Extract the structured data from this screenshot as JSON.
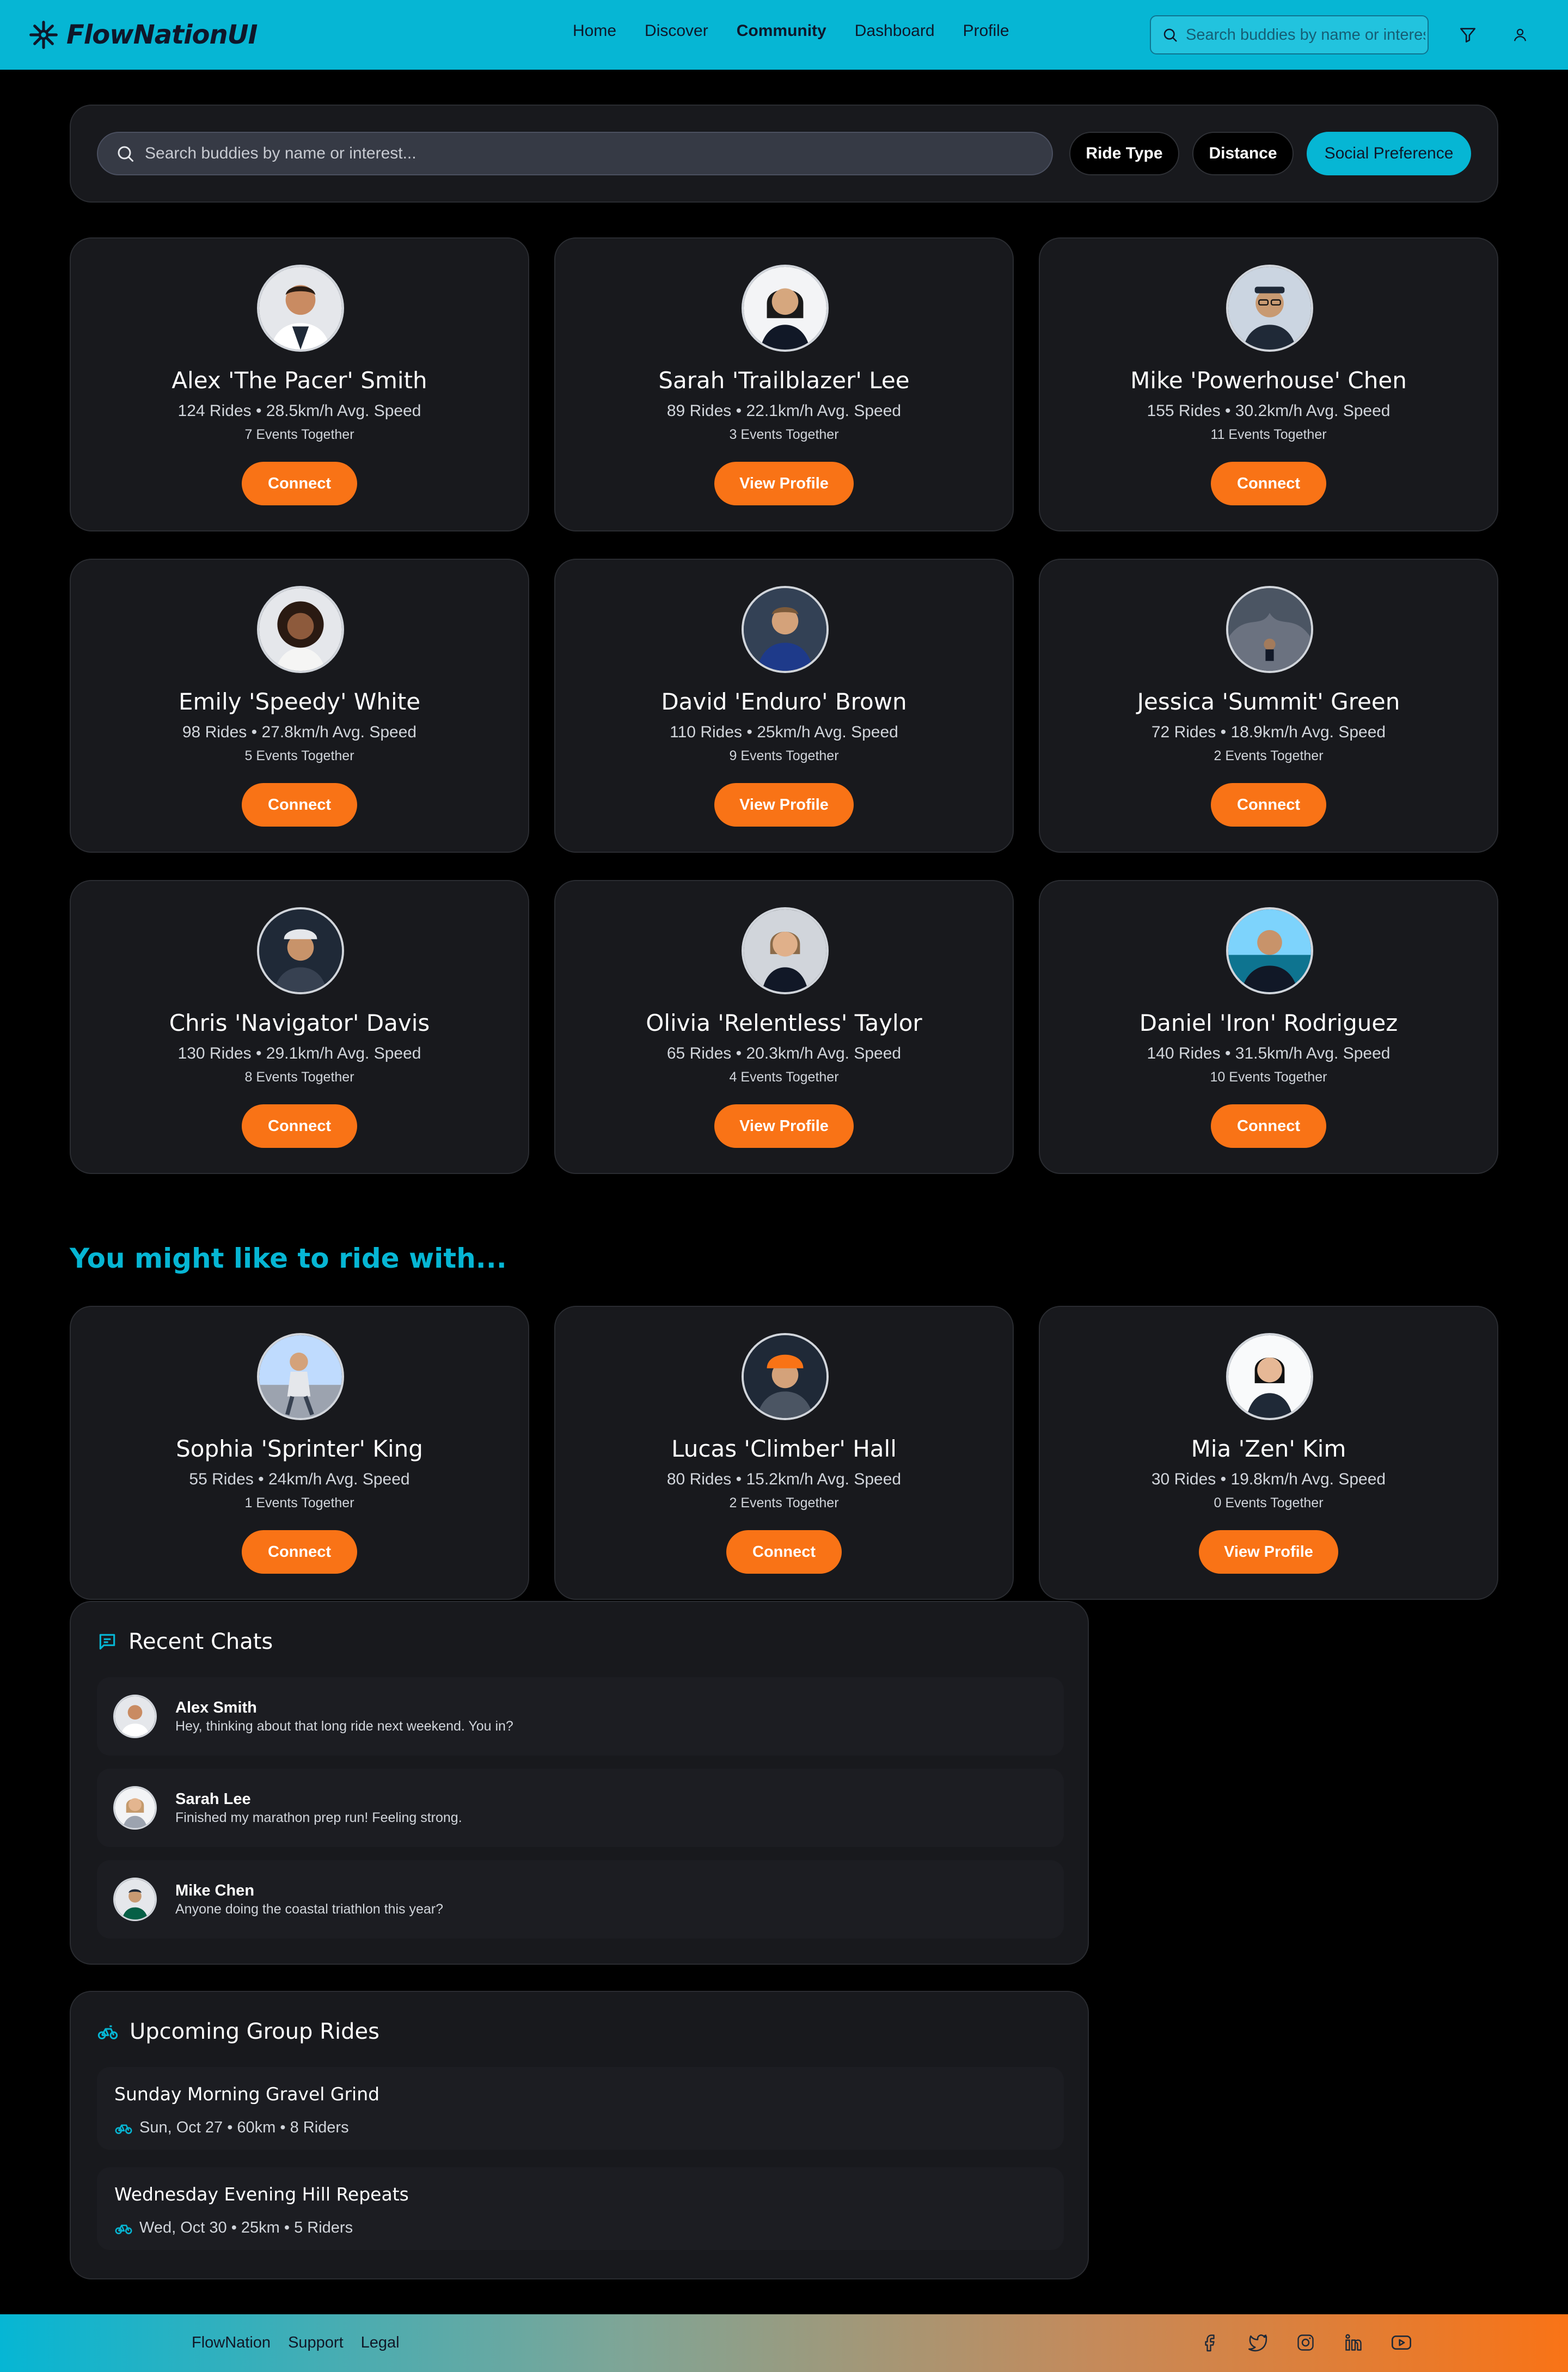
{
  "brand": {
    "name": "FlowNationUI"
  },
  "nav": [
    {
      "label": "Home",
      "active": false
    },
    {
      "label": "Discover",
      "active": false
    },
    {
      "label": "Community",
      "active": true
    },
    {
      "label": "Dashboard",
      "active": false
    },
    {
      "label": "Profile",
      "active": false
    }
  ],
  "header": {
    "search_placeholder": "Search buddies by name or interest...",
    "filter_icon": "filter-icon",
    "user_icon": "user-icon"
  },
  "filters": {
    "search_placeholder": "Search buddies by name or interest...",
    "pills": [
      {
        "label": "Ride Type",
        "active": false
      },
      {
        "label": "Distance",
        "active": false
      },
      {
        "label": "Social Preference",
        "active": true
      }
    ]
  },
  "buddies": [
    {
      "name": "Alex 'The Pacer' Smith",
      "stats": "124 Rides • 28.5km/h Avg. Speed",
      "events": "7 Events Together",
      "action": "Connect"
    },
    {
      "name": "Sarah 'Trailblazer' Lee",
      "stats": "89 Rides • 22.1km/h Avg. Speed",
      "events": "3 Events Together",
      "action": "View Profile"
    },
    {
      "name": "Mike 'Powerhouse' Chen",
      "stats": "155 Rides • 30.2km/h Avg. Speed",
      "events": "11 Events Together",
      "action": "Connect"
    },
    {
      "name": "Emily 'Speedy' White",
      "stats": "98 Rides • 27.8km/h Avg. Speed",
      "events": "5 Events Together",
      "action": "Connect"
    },
    {
      "name": "David 'Enduro' Brown",
      "stats": "110 Rides • 25km/h Avg. Speed",
      "events": "9 Events Together",
      "action": "View Profile"
    },
    {
      "name": "Jessica 'Summit' Green",
      "stats": "72 Rides • 18.9km/h Avg. Speed",
      "events": "2 Events Together",
      "action": "Connect"
    },
    {
      "name": "Chris 'Navigator' Davis",
      "stats": "130 Rides • 29.1km/h Avg. Speed",
      "events": "8 Events Together",
      "action": "Connect"
    },
    {
      "name": "Olivia 'Relentless' Taylor",
      "stats": "65 Rides • 20.3km/h Avg. Speed",
      "events": "4 Events Together",
      "action": "View Profile"
    },
    {
      "name": "Daniel 'Iron' Rodriguez",
      "stats": "140 Rides • 31.5km/h Avg. Speed",
      "events": "10 Events Together",
      "action": "Connect"
    }
  ],
  "suggestions": {
    "title": "You might like to ride with...",
    "items": [
      {
        "name": "Sophia 'Sprinter' King",
        "stats": "55 Rides • 24km/h Avg. Speed",
        "events": "1 Events Together",
        "action": "Connect"
      },
      {
        "name": "Lucas 'Climber' Hall",
        "stats": "80 Rides • 15.2km/h Avg. Speed",
        "events": "2 Events Together",
        "action": "Connect"
      },
      {
        "name": "Mia 'Zen' Kim",
        "stats": "30 Rides • 19.8km/h Avg. Speed",
        "events": "0 Events Together",
        "action": "View Profile"
      }
    ]
  },
  "chats": {
    "title": "Recent Chats",
    "items": [
      {
        "name": "Alex Smith",
        "message": "Hey, thinking about that long ride next weekend. You in?"
      },
      {
        "name": "Sarah Lee",
        "message": "Finished my marathon prep run! Feeling strong."
      },
      {
        "name": "Mike Chen",
        "message": "Anyone doing the coastal triathlon this year?"
      }
    ]
  },
  "rides": {
    "title": "Upcoming Group Rides",
    "items": [
      {
        "title": "Sunday Morning Gravel Grind",
        "meta": "Sun, Oct 27 • 60km • 8 Riders"
      },
      {
        "title": "Wednesday Evening Hill Repeats",
        "meta": "Wed, Oct 30 • 25km • 5 Riders"
      }
    ]
  },
  "footer": {
    "links": [
      "FlowNation",
      "Support",
      "Legal"
    ],
    "socials": [
      "facebook-icon",
      "twitter-icon",
      "instagram-icon",
      "linkedin-icon",
      "youtube-icon"
    ]
  },
  "colors": {
    "accent": "#06b6d4",
    "action": "#f97316",
    "card": "#18191d",
    "background": "#000000"
  }
}
